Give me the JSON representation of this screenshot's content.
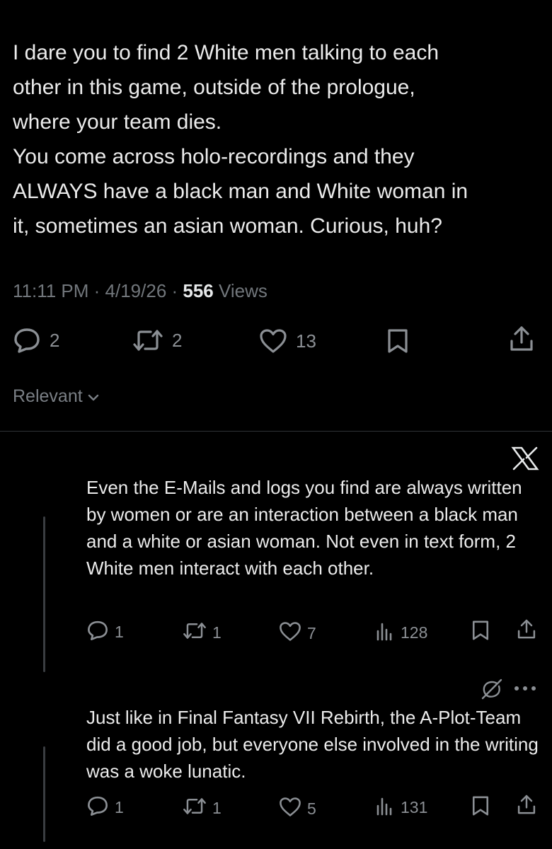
{
  "tweet": {
    "text": "I dare you to find 2 White men talking to each\nother in this game, outside of the prologue,\nwhere your team dies.\nYou come across holo-recordings and they\nALWAYS have a black man and White woman in\nit, sometimes an asian woman. Curious, huh?",
    "time": "11:11 PM · 4/19/26 · ",
    "views_count": "556",
    "views_label": " Views",
    "replies": "2",
    "reposts": "2",
    "likes": "13"
  },
  "sort": {
    "label": "Relevant"
  },
  "replies": [
    {
      "text": "Even the E-Mails and logs you find are always written by women or are an interaction between a black man and a white or asian woman. Not even in text form, 2 White men interact with each other.",
      "replies": "1",
      "reposts": "1",
      "likes": "7",
      "views": "128"
    },
    {
      "text": "Just like in Final Fantasy VII Rebirth, the A-Plot-Team did a good job, but everyone else involved in the writing was a woke lunatic.",
      "replies": "1",
      "reposts": "1",
      "likes": "5",
      "views": "131"
    }
  ],
  "icons": {
    "reply": "speech-bubble-icon",
    "repost": "repost-arrows-icon",
    "like": "heart-icon",
    "bookmark": "bookmark-icon",
    "share": "share-upload-icon",
    "views": "bar-chart-icon",
    "close": "x-logo-icon",
    "grok": "grok-slash-icon",
    "more": "more-dots-icon"
  },
  "colors": {
    "background": "#000000",
    "text": "#e7e9ea",
    "muted": "#71767b"
  }
}
